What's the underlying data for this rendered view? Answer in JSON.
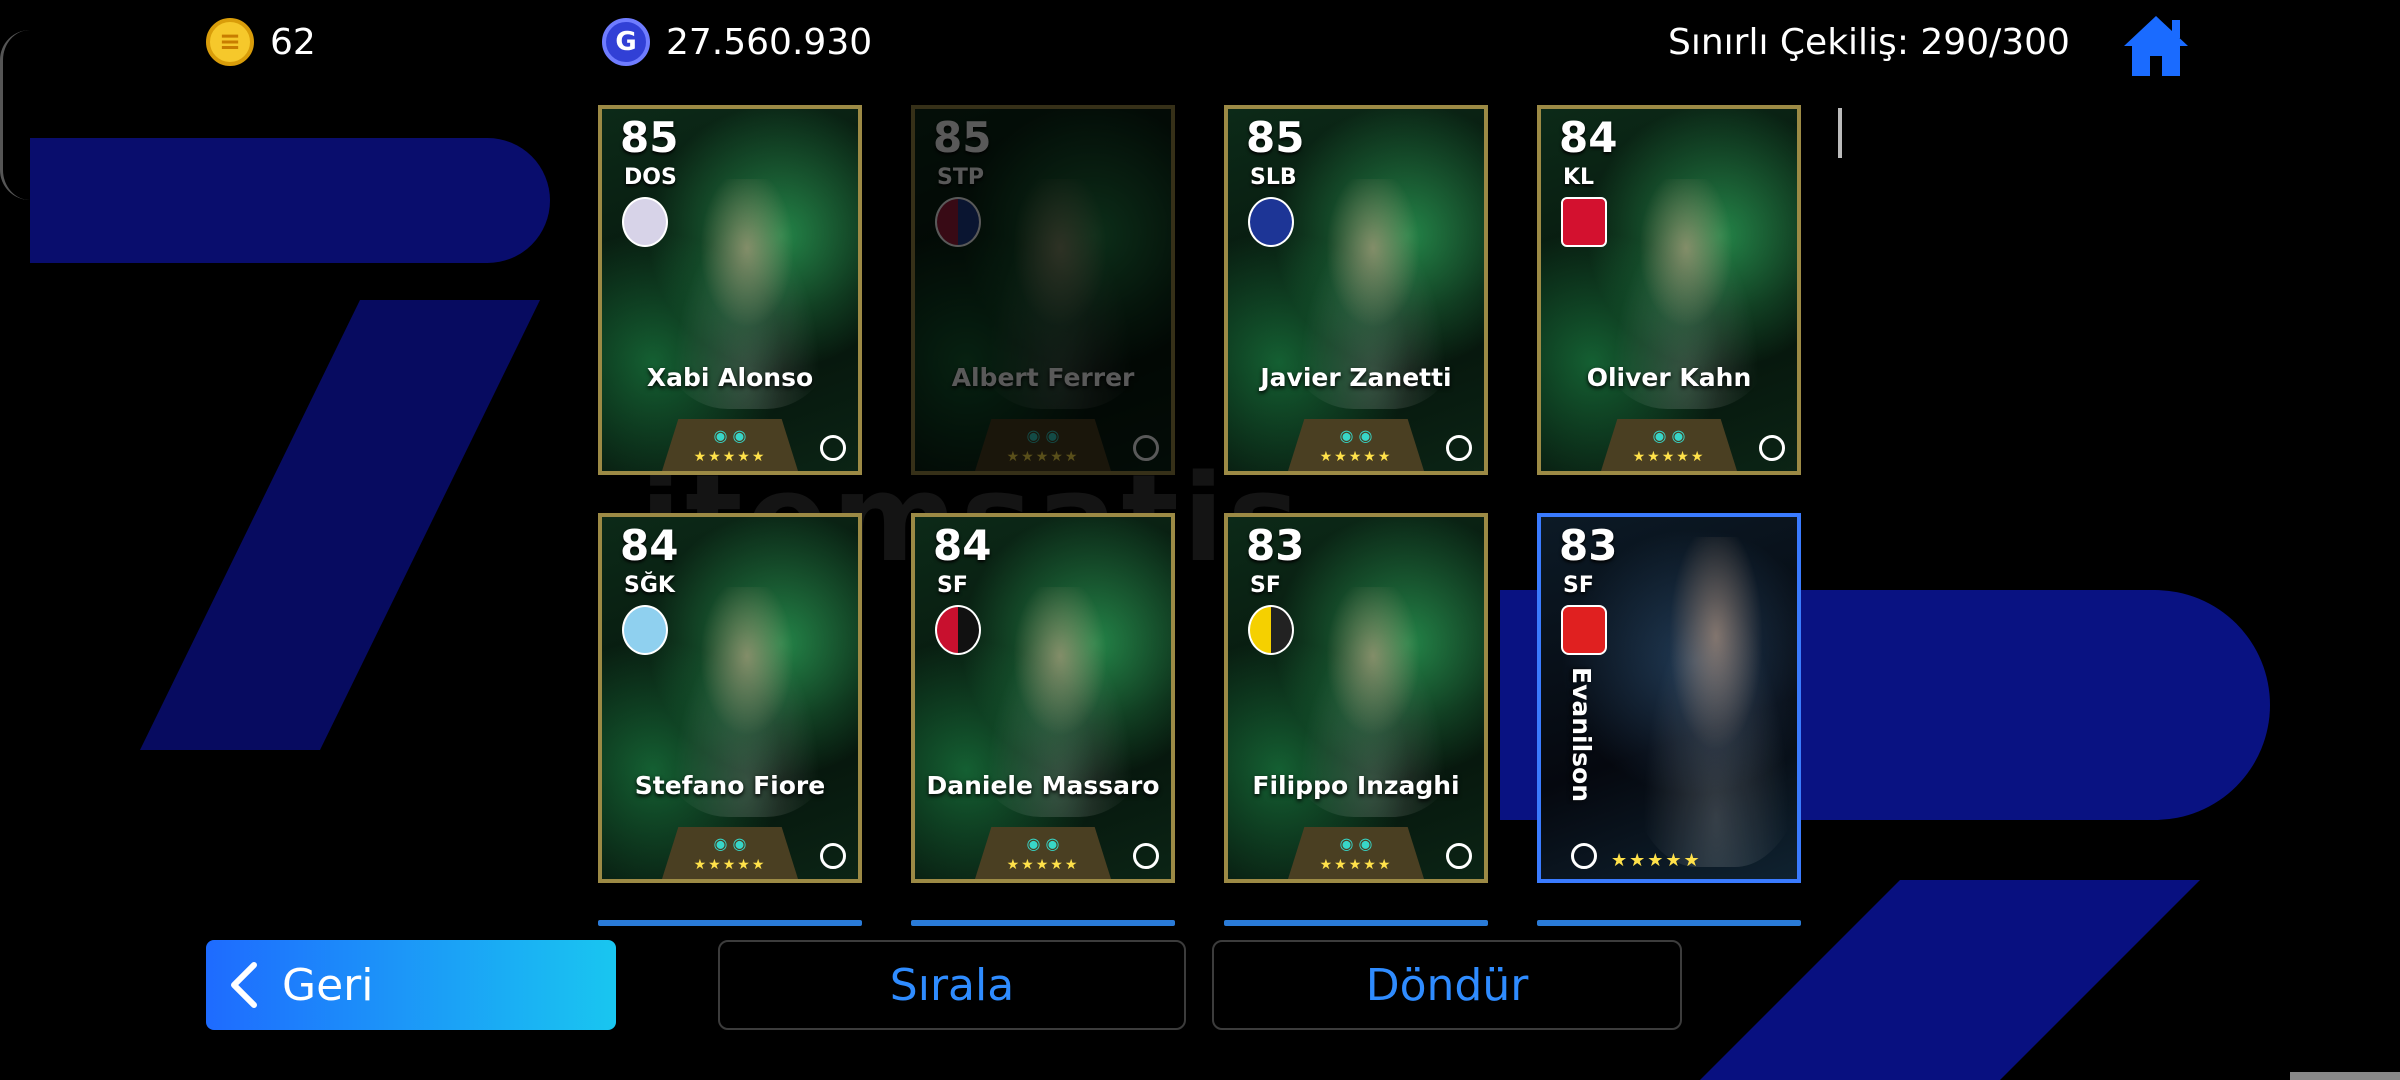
{
  "hud": {
    "coins": "62",
    "gp": "27.560.930",
    "draw_limit": "Sınırlı Çekiliş: 290/300"
  },
  "cards": [
    {
      "rating": "85",
      "position": "DOS",
      "name": "Xabi Alonso",
      "dimmed": false
    },
    {
      "rating": "85",
      "position": "STP",
      "name": "Albert Ferrer",
      "dimmed": true
    },
    {
      "rating": "85",
      "position": "SLB",
      "name": "Javier Zanetti",
      "dimmed": false
    },
    {
      "rating": "84",
      "position": "KL",
      "name": "Oliver Kahn",
      "dimmed": false
    },
    {
      "rating": "84",
      "position": "SĞK",
      "name": "Stefano Fiore",
      "dimmed": false
    },
    {
      "rating": "84",
      "position": "SF",
      "name": "Daniele Massaro",
      "dimmed": false
    },
    {
      "rating": "83",
      "position": "SF",
      "name": "Filippo Inzaghi",
      "dimmed": false
    },
    {
      "rating": "83",
      "position": "SF",
      "name": "Evanilson",
      "dimmed": false
    }
  ],
  "buttons": {
    "back": "Geri",
    "sort": "Sırala",
    "spin": "Döndür"
  },
  "stars": "★★★★★",
  "colors": {
    "gold_border": "#9c8a45",
    "blue_border": "#3a7bff",
    "button_text": "#2f8cff",
    "back_gradient_start": "#1e6bff",
    "back_gradient_end": "#19c6f0"
  }
}
